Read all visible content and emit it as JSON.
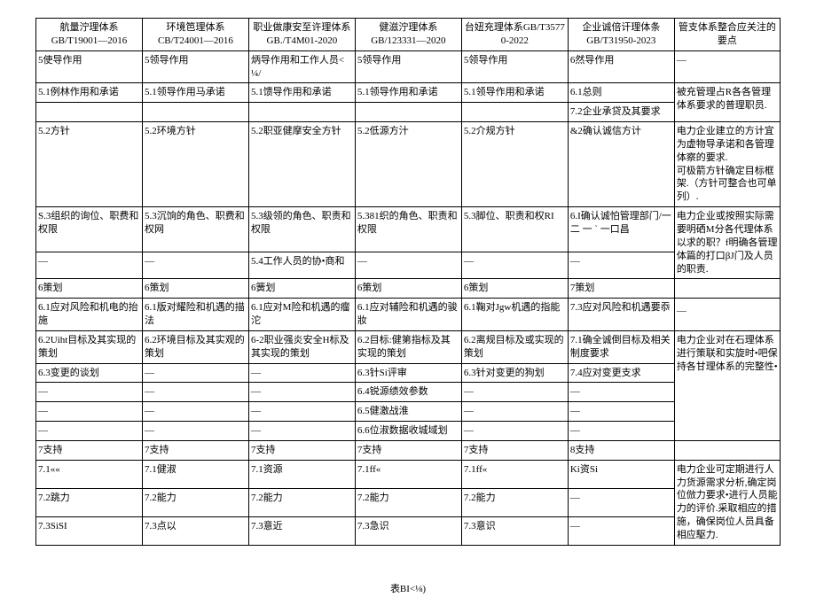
{
  "headers": [
    {
      "l1": "航量泞理体系",
      "l2": "GB/T19001—2016"
    },
    {
      "l1": "环境笆理体系",
      "l2": "CB/T24001—2016"
    },
    {
      "l1": "职业做康安至许理体系",
      "l2": "GB./T4M01-2020"
    },
    {
      "l1": "健滋泞理体系",
      "l2": "GB/123331—2020"
    },
    {
      "l1": "台妞充理体系GB/T35770-2022",
      "l2": ""
    },
    {
      "l1": "企业诚倍讦理体条",
      "l2": "GB/T31950-2023"
    },
    {
      "l1": "管支体系整合应关注的要点",
      "l2": ""
    }
  ],
  "rows": [
    [
      "5使导作用",
      "5领导作用",
      "炳导作用和工作人员<¼/",
      "5领导作用",
      "5领导作用",
      "6然导作用",
      "—"
    ],
    [
      "5.1例林作用和承诺",
      "5.1领导作用马承诺",
      "5.1馈导作用和承诺",
      "5.1领导作用和承诺",
      "5.1领导作用和承诺",
      "6.1总则",
      "被充管理占R各各管理体系要求的普理职员."
    ],
    [
      "",
      "",
      "",
      "",
      "",
      "7.2企业承贷及其要求",
      ""
    ],
    [
      "5.2方针",
      "5.2环境方针",
      "5.2职亚健摩安全方针",
      "5.2低源方汁",
      "5.2介规方针",
      "&2确认诚信方计",
      "电力企业建立的方计宜为虚物导承诺和各管理体察的要求.\n可极箭方针确定目标框架.（方针可整合也可单列）."
    ],
    [
      "S.3组织的询位、职费和权限",
      "5.3沉饷的角色、职费和权网",
      "5.3级领的角色、职责和权限",
      "5.381织的角色、职责和权限",
      "5.3脚位、职责和权RI",
      "6.I确认诚怕管理部门/一二 一 ˋ 一口昌",
      "电力企业或按照实际需要明硒M分各代理体系以求的职？f明确各管理体篇的打口βJ门及人员的职责."
    ],
    [
      "—",
      "—",
      "5.4工作人员的协•商和",
      "—",
      "—",
      "—",
      ""
    ],
    [
      "6策划",
      "6策划",
      "6簧划",
      "6策划",
      "6策划",
      "7策划",
      ""
    ],
    [
      "6.1应对风险和机电的抬施",
      "6.1版对耀险和机遇的描法",
      "6.1应对M险和机遇的瘤沱",
      "6.1应对辅险和机遇的骏妝",
      "6.1鞠对Jgw机遇的指能",
      "7.3应对风险和机遇要忝",
      "__"
    ],
    [
      "6.2Uiht目标及其实现的策划",
      "6.2环境目标及其实观的策划",
      "6-2职业强炎安全H标及其实现的策划",
      "6.2目标:健第指标及其实现的策划",
      "6.2离规目标及或实现的策划",
      "7.1确全诚倒目标及相关制度要求",
      "电力企业对在石理体系进行策联和实旋时•吧保持各甘理体系的完整性•"
    ],
    [
      "6.3变更的谈划",
      "—",
      "—",
      "6.3针Si评审",
      "6.3针对变更的狗划",
      "7.4应对变更支求",
      ""
    ],
    [
      "—",
      "—",
      "—",
      "6.4锐源绩效参数",
      "—",
      "—",
      ""
    ],
    [
      "—",
      "—",
      "—",
      "6.5健激战淮",
      "—",
      "—",
      ""
    ],
    [
      "—",
      "—",
      "—",
      "6.6位淑数据收城域划",
      "—",
      "—",
      ""
    ],
    [
      "7支持",
      "7支持",
      "7支持",
      "7支持",
      "7支持",
      "8支持",
      ""
    ],
    [
      "7.1««",
      "7.1健淑",
      "7.1资源",
      "7.1ff«",
      "7.1ff«",
      "Ki资Si",
      "电力企业可定期进行人力货源需求分析,确定岗位倣力要求•进行人员能力的评价.采取相应的措施，确保岗位人员具备相应駆力."
    ],
    [
      "7.2跳力",
      "7.2能力",
      "7.2能力",
      "7.2能力",
      "7.2能力",
      "—",
      ""
    ],
    [
      "7.3SiSI",
      "7.3点以",
      "7.3意近",
      "7.3急识",
      "7.3意识",
      "—",
      ""
    ]
  ],
  "caption": "表BI<⅛)"
}
